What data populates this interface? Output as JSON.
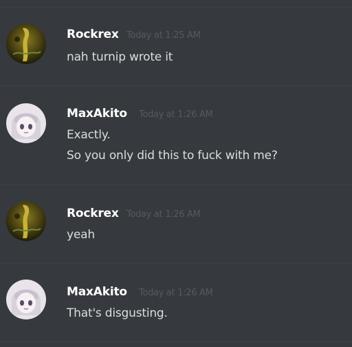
{
  "messages": [
    {
      "author": "Rockrex",
      "avatar_icon": "rockrex-avatar-icon",
      "timestamp": "Today at 1:25 AM",
      "lines": [
        "nah turnip wrote it"
      ]
    },
    {
      "author": "MaxAkito",
      "avatar_icon": "maxakito-avatar-icon",
      "timestamp": "Today at 1:26 AM",
      "lines": [
        "Exactly.",
        "So you only did this to fuck with me?"
      ]
    },
    {
      "author": "Rockrex",
      "avatar_icon": "rockrex-avatar-icon",
      "timestamp": "Today at 1:26 AM",
      "lines": [
        "yeah"
      ]
    },
    {
      "author": "MaxAkito",
      "avatar_icon": "maxakito-avatar-icon",
      "timestamp": "Today at 1:26 AM",
      "lines": [
        "That's disgusting."
      ]
    }
  ],
  "colors": {
    "background": "#36393e",
    "divider": "#3e4146",
    "username": "#ffffff",
    "message_text": "#dcddde",
    "timestamp": "#56595e"
  }
}
